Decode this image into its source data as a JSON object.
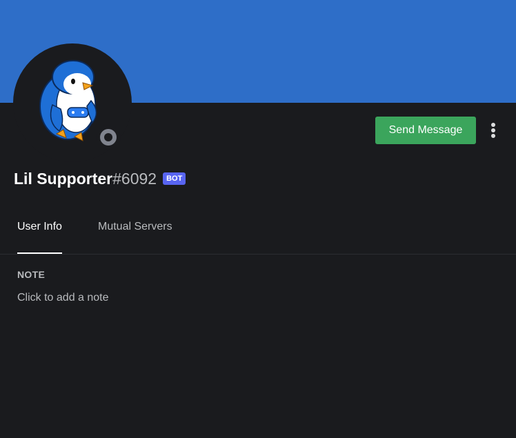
{
  "profile": {
    "banner_color": "#2e6ec8",
    "avatar_icon": "penguin-icon",
    "status_color": "#80848e",
    "username": "Lil Supporter",
    "discriminator": "#6092",
    "bot_tag": "BOT",
    "bot_tag_color": "#5865f2"
  },
  "actions": {
    "send_message": "Send Message",
    "send_message_color": "#3ba55c",
    "more_icon": "more-vertical-icon"
  },
  "tabs": [
    {
      "label": "User Info",
      "active": true
    },
    {
      "label": "Mutual Servers",
      "active": false
    }
  ],
  "note": {
    "header": "NOTE",
    "placeholder": "Click to add a note"
  }
}
